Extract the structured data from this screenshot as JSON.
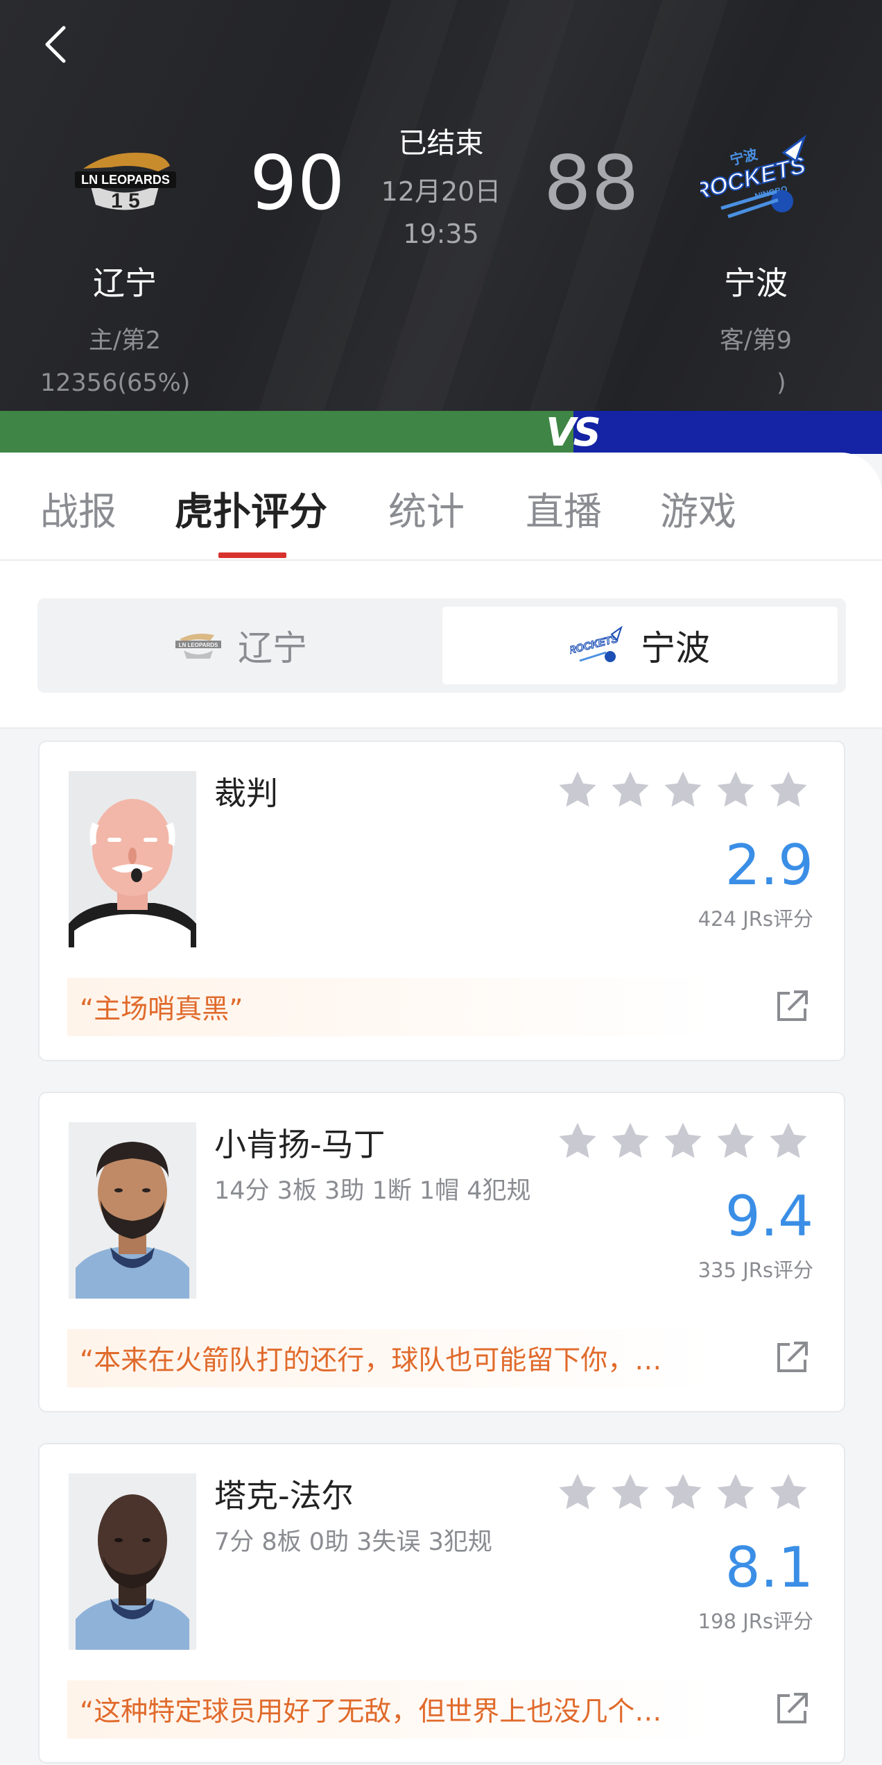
{
  "header": {
    "home": {
      "name": "辽宁",
      "rank": "主/第2",
      "score": "90",
      "support": "12356(65%)",
      "logo": "ln-leopards-logo"
    },
    "away": {
      "name": "宁波",
      "rank": "客/第9",
      "score": "88",
      "support": ")",
      "logo": "ningbo-rockets-logo"
    },
    "status": "已结束",
    "date": "12月20日",
    "time": "19:35",
    "vs": "VS"
  },
  "support_share": {
    "home": 0.65,
    "away": 0.35
  },
  "tabs": [
    {
      "label": "战报",
      "active": false
    },
    {
      "label": "虎扑评分",
      "active": true
    },
    {
      "label": "统计",
      "active": false
    },
    {
      "label": "直播",
      "active": false
    },
    {
      "label": "游戏",
      "active": false
    }
  ],
  "team_selector": [
    {
      "label": "辽宁",
      "selected": false
    },
    {
      "label": "宁波",
      "selected": true
    }
  ],
  "cards": [
    {
      "name": "裁判",
      "stats": "",
      "rating": "2.9",
      "count": "424 JRs评分",
      "quote": "“主场哨真黑”",
      "avatar": "referee-avatar"
    },
    {
      "name": "小肯扬-马丁",
      "stats": "14分 3板 3助 1断 1帽 4犯规",
      "rating": "9.4",
      "count": "335 JRs评分",
      "quote": "“本来在火箭队打的还行，球队也可能留下你，…",
      "avatar": "player-avatar"
    },
    {
      "name": "塔克-法尔",
      "stats": "7分 8板 0助 3失误 3犯规",
      "rating": "8.1",
      "count": "198 JRs评分",
      "quote": "“这种特定球员用好了无敌，但世界上也没几个…",
      "avatar": "player-avatar"
    }
  ],
  "colors": {
    "header_bg": "#26272b",
    "home_bar": "#3f8545",
    "away_bar": "#1424a4",
    "tab_accent": "#d8322f",
    "rating": "#3a8ee6",
    "quote_text": "#e06a2b",
    "star": "#c9cad1"
  }
}
